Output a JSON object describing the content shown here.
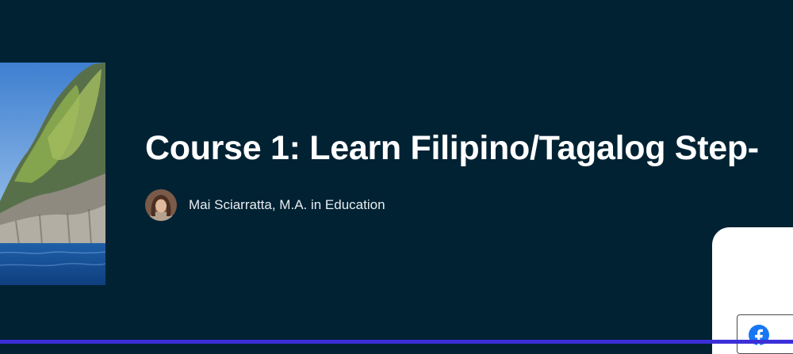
{
  "course": {
    "title": "Course 1: Learn Filipino/Tagalog Step-",
    "image_alt": "Limestone cliff over blue sea"
  },
  "instructor": {
    "name": "Mai Sciarratta, M.A. in Education"
  },
  "share": {
    "facebook_icon": "facebook-icon"
  },
  "colors": {
    "background": "#012233",
    "accent_bar": "#3b2fd8",
    "facebook": "#1877f2"
  }
}
